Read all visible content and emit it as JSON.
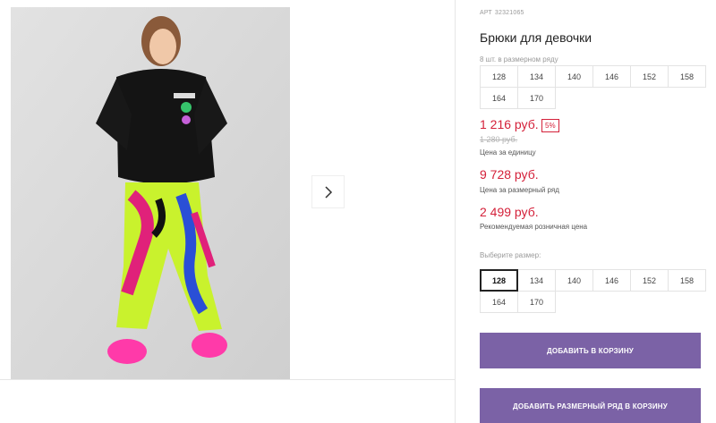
{
  "product": {
    "art_label": "АРТ",
    "art_number": "32321065",
    "title": "Брюки для девочки"
  },
  "pack_sizes": {
    "hint": "8 шт. в размерном ряду",
    "sizes": [
      "128",
      "134",
      "140",
      "146",
      "152",
      "158",
      "164",
      "170"
    ]
  },
  "pricing": {
    "unit_price": "1 216 руб.",
    "discount": "5%",
    "old_price": "1 280 руб.",
    "unit_label": "Цена за единицу",
    "pack_price": "9 728 руб.",
    "pack_label": "Цена за размерный ряд",
    "retail_price": "2 499 руб.",
    "retail_label": "Рекомендуемая розничная цена"
  },
  "size_select": {
    "hint": "Выберите размер:",
    "selected": "128",
    "sizes": [
      "128",
      "134",
      "140",
      "146",
      "152",
      "158",
      "164",
      "170"
    ]
  },
  "buttons": {
    "add_to_cart": "ДОБАВИТЬ В КОРЗИНУ",
    "add_pack_to_cart": "ДОБАВИТЬ РАЗМЕРНЫЙ РЯД В КОРЗИНУ"
  },
  "colors": {
    "accent": "#7b62a6",
    "price_red": "#d4213a"
  }
}
